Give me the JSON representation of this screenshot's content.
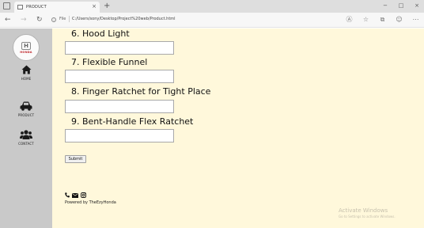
{
  "browser": {
    "tab_title": "PRODUCT",
    "tab_close": "×",
    "new_tab": "+",
    "window_controls": [
      "−",
      "□",
      "×"
    ],
    "nav": {
      "back": "←",
      "forward": "→",
      "reload": "↻"
    },
    "address_prefix": "File",
    "url": "C:/Users/sony/Desktop/Project%20web/Product.html",
    "toolbar_icons": [
      "read-aloud-icon",
      "favorites-icon",
      "collections-icon",
      "profile-icon",
      "more-icon"
    ],
    "toolbar_glyphs": [
      "Ⓐ",
      "☆",
      "⧉",
      "☺",
      "⋯"
    ]
  },
  "sidebar": {
    "logo": {
      "emblem": "H",
      "word": "HONDA"
    },
    "items": [
      {
        "label": "HOME",
        "icon": "home-icon"
      },
      {
        "label": "PRODUCT",
        "icon": "car-icon"
      },
      {
        "label": "CONTACT",
        "icon": "users-icon"
      }
    ]
  },
  "form": {
    "questions": [
      {
        "label": "6. Hood Light",
        "value": ""
      },
      {
        "label": "7. Flexible Funnel",
        "value": ""
      },
      {
        "label": "8. Finger Ratchet for Tight Place",
        "value": ""
      },
      {
        "label": "9. Bent-Handle Flex Ratchet",
        "value": ""
      }
    ],
    "submit_label": "Submit"
  },
  "footer": {
    "social_icons": [
      "phone-icon",
      "mail-icon",
      "instagram-icon"
    ],
    "powered_by": "Powered by TheEzyHonda"
  },
  "watermark": {
    "title": "Activate Windows",
    "subtitle": "Go to Settings to activate Windows."
  },
  "colors": {
    "content_bg": "#fff8db",
    "sidebar_bg": "#c9c9c9",
    "logo_red": "#c0282d"
  }
}
